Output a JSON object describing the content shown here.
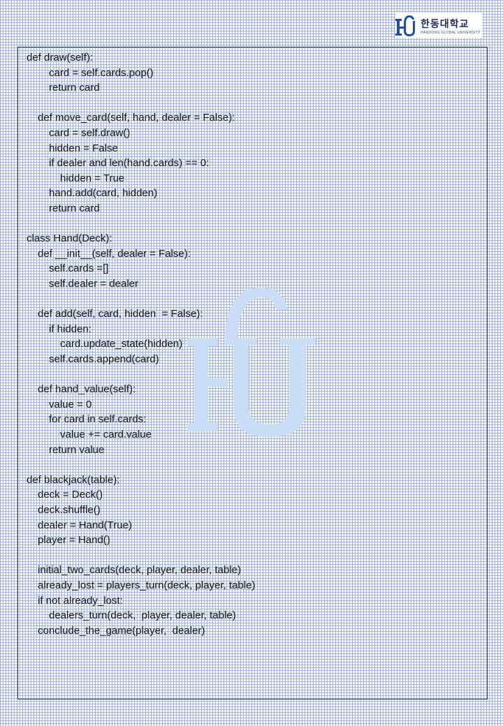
{
  "header": {
    "logo_text": "한동대학교",
    "logo_subtext": "HANDONG GLOBAL UNIVERSITY"
  },
  "code": {
    "lines": [
      {
        "text": "def draw(self):",
        "indent": 0
      },
      {
        "text": "card = self.cards.pop()",
        "indent": 2
      },
      {
        "text": "return card",
        "indent": 2
      },
      {
        "text": "",
        "indent": 0
      },
      {
        "text": "def move_card(self, hand, dealer = False):",
        "indent": 1
      },
      {
        "text": "card = self.draw()",
        "indent": 2
      },
      {
        "text": "hidden = False",
        "indent": 2
      },
      {
        "text": "if dealer and len(hand.cards) == 0:",
        "indent": 2
      },
      {
        "text": "hidden = True",
        "indent": 3
      },
      {
        "text": "hand.add(card, hidden)",
        "indent": 2
      },
      {
        "text": "return card",
        "indent": 2
      },
      {
        "text": "",
        "indent": 0
      },
      {
        "text": "class Hand(Deck):",
        "indent": 0
      },
      {
        "text": "def __init__(self, dealer = False):",
        "indent": 1
      },
      {
        "text": "self.cards =[]",
        "indent": 2
      },
      {
        "text": "self.dealer = dealer",
        "indent": 2
      },
      {
        "text": "",
        "indent": 0
      },
      {
        "text": "def add(self, card, hidden  = False):",
        "indent": 1
      },
      {
        "text": "if hidden:",
        "indent": 2
      },
      {
        "text": "card.update_state(hidden)",
        "indent": 3
      },
      {
        "text": "self.cards.append(card)",
        "indent": 2
      },
      {
        "text": "",
        "indent": 0
      },
      {
        "text": "def hand_value(self):",
        "indent": 1
      },
      {
        "text": "value = 0",
        "indent": 2
      },
      {
        "text": "for card in self.cards:",
        "indent": 2
      },
      {
        "text": "value += card.value",
        "indent": 3
      },
      {
        "text": "return value",
        "indent": 2
      },
      {
        "text": "",
        "indent": 0
      },
      {
        "text": "def blackjack(table):",
        "indent": 0
      },
      {
        "text": "deck = Deck()",
        "indent": 1
      },
      {
        "text": "deck.shuffle()",
        "indent": 1
      },
      {
        "text": "dealer = Hand(True)",
        "indent": 1
      },
      {
        "text": "player = Hand()",
        "indent": 1
      },
      {
        "text": "",
        "indent": 0
      },
      {
        "text": "initial_two_cards(deck, player, dealer, table)",
        "indent": 1
      },
      {
        "text": "already_lost = players_turn(deck, player, table)",
        "indent": 1
      },
      {
        "text": "if not already_lost:",
        "indent": 1
      },
      {
        "text": "dealers_turn(deck,  player, dealer, table)",
        "indent": 2
      },
      {
        "text": "conclude_the_game(player,  dealer)",
        "indent": 1
      }
    ]
  },
  "colors": {
    "grid": "#9fb4d6",
    "frame": "#2c3a66",
    "watermark": "#c9def6",
    "logo_mark": "#1f4fa0",
    "text": "#141414"
  }
}
